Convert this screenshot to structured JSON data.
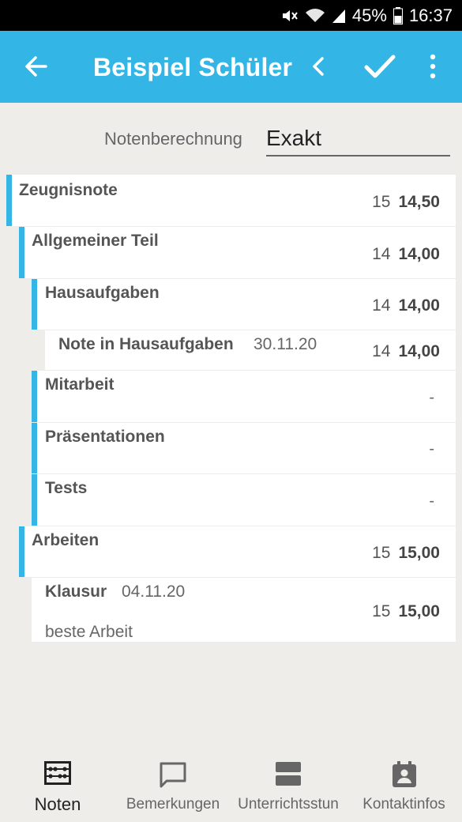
{
  "status_bar": {
    "battery": "45%",
    "time": "16:37",
    "icons": [
      "mute-icon",
      "wifi-icon",
      "signal-icon",
      "battery-icon"
    ]
  },
  "app_bar": {
    "title": "Beispiel Schüler",
    "icons": [
      "back-arrow-icon",
      "chevron-left-icon",
      "check-icon",
      "more-vert-icon"
    ]
  },
  "calculation": {
    "label": "Notenberechnung",
    "value": "Exakt"
  },
  "grades": [
    {
      "name": "Zeugnisnote",
      "points": "15",
      "average": "14,50"
    },
    {
      "name": "Allgemeiner Teil",
      "points": "14",
      "average": "14,00"
    },
    {
      "name": "Hausaufgaben",
      "points": "14",
      "average": "14,00"
    },
    {
      "name": "Note in Hausaufgaben",
      "date": "30.11.20",
      "points": "14",
      "average": "14,00"
    },
    {
      "name": "Mitarbeit",
      "empty": "-"
    },
    {
      "name": "Präsentationen",
      "empty": "-"
    },
    {
      "name": "Tests",
      "empty": "-"
    },
    {
      "name": "Arbeiten",
      "points": "15",
      "average": "15,00"
    },
    {
      "name": "Klausur",
      "date": "04.11.20",
      "note": "beste Arbeit",
      "points": "15",
      "average": "15,00"
    }
  ],
  "bottom_nav": [
    {
      "label": "Noten",
      "icon": "abacus-icon",
      "active": true
    },
    {
      "label": "Bemerkungen",
      "icon": "comment-icon"
    },
    {
      "label": "Unterrichtsstun",
      "icon": "lessons-icon"
    },
    {
      "label": "Kontaktinfos",
      "icon": "contact-card-icon"
    }
  ],
  "colors": {
    "accent": "#33b5e5",
    "background": "#efedea"
  }
}
